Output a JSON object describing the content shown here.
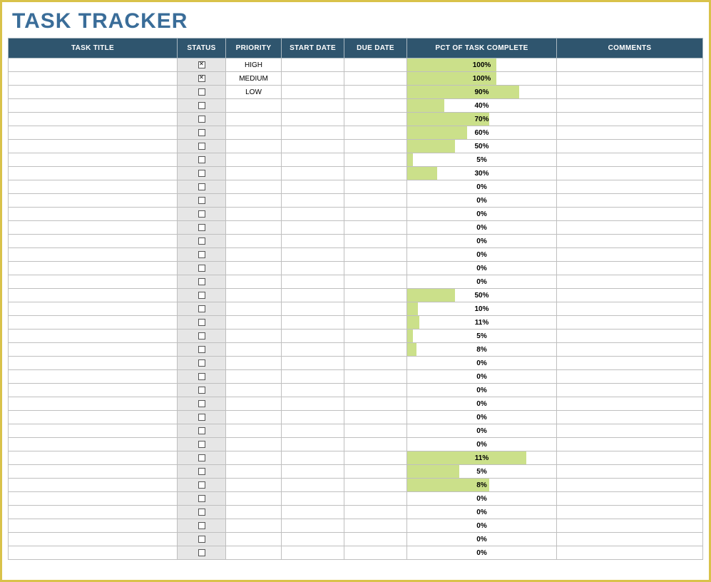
{
  "tracker": {
    "title": "TASK TRACKER",
    "columns": {
      "task_title": "TASK TITLE",
      "status": "STATUS",
      "priority": "PRIORITY",
      "start_date": "START DATE",
      "due_date": "DUE DATE",
      "pct_complete": "PCT OF TASK COMPLETE",
      "comments": "COMMENTS"
    },
    "rows": [
      {
        "task_title": "",
        "status_checked": true,
        "priority": "HIGH",
        "start_date": "",
        "due_date": "",
        "pct": 100,
        "pct_bar": 60,
        "comments": ""
      },
      {
        "task_title": "",
        "status_checked": true,
        "priority": "MEDIUM",
        "start_date": "",
        "due_date": "",
        "pct": 100,
        "pct_bar": 60,
        "comments": ""
      },
      {
        "task_title": "",
        "status_checked": false,
        "priority": "LOW",
        "start_date": "",
        "due_date": "",
        "pct": 90,
        "pct_bar": 75,
        "comments": ""
      },
      {
        "task_title": "",
        "status_checked": false,
        "priority": "",
        "start_date": "",
        "due_date": "",
        "pct": 40,
        "pct_bar": 25,
        "comments": ""
      },
      {
        "task_title": "",
        "status_checked": false,
        "priority": "",
        "start_date": "",
        "due_date": "",
        "pct": 70,
        "pct_bar": 55,
        "comments": ""
      },
      {
        "task_title": "",
        "status_checked": false,
        "priority": "",
        "start_date": "",
        "due_date": "",
        "pct": 60,
        "pct_bar": 40,
        "comments": ""
      },
      {
        "task_title": "",
        "status_checked": false,
        "priority": "",
        "start_date": "",
        "due_date": "",
        "pct": 50,
        "pct_bar": 32,
        "comments": ""
      },
      {
        "task_title": "",
        "status_checked": false,
        "priority": "",
        "start_date": "",
        "due_date": "",
        "pct": 5,
        "pct_bar": 4,
        "comments": ""
      },
      {
        "task_title": "",
        "status_checked": false,
        "priority": "",
        "start_date": "",
        "due_date": "",
        "pct": 30,
        "pct_bar": 20,
        "comments": ""
      },
      {
        "task_title": "",
        "status_checked": false,
        "priority": "",
        "start_date": "",
        "due_date": "",
        "pct": 0,
        "pct_bar": 0,
        "comments": ""
      },
      {
        "task_title": "",
        "status_checked": false,
        "priority": "",
        "start_date": "",
        "due_date": "",
        "pct": 0,
        "pct_bar": 0,
        "comments": ""
      },
      {
        "task_title": "",
        "status_checked": false,
        "priority": "",
        "start_date": "",
        "due_date": "",
        "pct": 0,
        "pct_bar": 0,
        "comments": ""
      },
      {
        "task_title": "",
        "status_checked": false,
        "priority": "",
        "start_date": "",
        "due_date": "",
        "pct": 0,
        "pct_bar": 0,
        "comments": ""
      },
      {
        "task_title": "",
        "status_checked": false,
        "priority": "",
        "start_date": "",
        "due_date": "",
        "pct": 0,
        "pct_bar": 0,
        "comments": ""
      },
      {
        "task_title": "",
        "status_checked": false,
        "priority": "",
        "start_date": "",
        "due_date": "",
        "pct": 0,
        "pct_bar": 0,
        "comments": ""
      },
      {
        "task_title": "",
        "status_checked": false,
        "priority": "",
        "start_date": "",
        "due_date": "",
        "pct": 0,
        "pct_bar": 0,
        "comments": ""
      },
      {
        "task_title": "",
        "status_checked": false,
        "priority": "",
        "start_date": "",
        "due_date": "",
        "pct": 0,
        "pct_bar": 0,
        "comments": ""
      },
      {
        "task_title": "",
        "status_checked": false,
        "priority": "",
        "start_date": "",
        "due_date": "",
        "pct": 50,
        "pct_bar": 32,
        "comments": ""
      },
      {
        "task_title": "",
        "status_checked": false,
        "priority": "",
        "start_date": "",
        "due_date": "",
        "pct": 10,
        "pct_bar": 7,
        "comments": ""
      },
      {
        "task_title": "",
        "status_checked": false,
        "priority": "",
        "start_date": "",
        "due_date": "",
        "pct": 11,
        "pct_bar": 8,
        "comments": ""
      },
      {
        "task_title": "",
        "status_checked": false,
        "priority": "",
        "start_date": "",
        "due_date": "",
        "pct": 5,
        "pct_bar": 4,
        "comments": ""
      },
      {
        "task_title": "",
        "status_checked": false,
        "priority": "",
        "start_date": "",
        "due_date": "",
        "pct": 8,
        "pct_bar": 6,
        "comments": ""
      },
      {
        "task_title": "",
        "status_checked": false,
        "priority": "",
        "start_date": "",
        "due_date": "",
        "pct": 0,
        "pct_bar": 0,
        "comments": ""
      },
      {
        "task_title": "",
        "status_checked": false,
        "priority": "",
        "start_date": "",
        "due_date": "",
        "pct": 0,
        "pct_bar": 0,
        "comments": ""
      },
      {
        "task_title": "",
        "status_checked": false,
        "priority": "",
        "start_date": "",
        "due_date": "",
        "pct": 0,
        "pct_bar": 0,
        "comments": ""
      },
      {
        "task_title": "",
        "status_checked": false,
        "priority": "",
        "start_date": "",
        "due_date": "",
        "pct": 0,
        "pct_bar": 0,
        "comments": ""
      },
      {
        "task_title": "",
        "status_checked": false,
        "priority": "",
        "start_date": "",
        "due_date": "",
        "pct": 0,
        "pct_bar": 0,
        "comments": ""
      },
      {
        "task_title": "",
        "status_checked": false,
        "priority": "",
        "start_date": "",
        "due_date": "",
        "pct": 0,
        "pct_bar": 0,
        "comments": ""
      },
      {
        "task_title": "",
        "status_checked": false,
        "priority": "",
        "start_date": "",
        "due_date": "",
        "pct": 0,
        "pct_bar": 0,
        "comments": ""
      },
      {
        "task_title": "",
        "status_checked": false,
        "priority": "",
        "start_date": "",
        "due_date": "",
        "pct": 11,
        "pct_bar": 80,
        "comments": ""
      },
      {
        "task_title": "",
        "status_checked": false,
        "priority": "",
        "start_date": "",
        "due_date": "",
        "pct": 5,
        "pct_bar": 35,
        "comments": ""
      },
      {
        "task_title": "",
        "status_checked": false,
        "priority": "",
        "start_date": "",
        "due_date": "",
        "pct": 8,
        "pct_bar": 55,
        "comments": ""
      },
      {
        "task_title": "",
        "status_checked": false,
        "priority": "",
        "start_date": "",
        "due_date": "",
        "pct": 0,
        "pct_bar": 0,
        "comments": ""
      },
      {
        "task_title": "",
        "status_checked": false,
        "priority": "",
        "start_date": "",
        "due_date": "",
        "pct": 0,
        "pct_bar": 0,
        "comments": ""
      },
      {
        "task_title": "",
        "status_checked": false,
        "priority": "",
        "start_date": "",
        "due_date": "",
        "pct": 0,
        "pct_bar": 0,
        "comments": ""
      },
      {
        "task_title": "",
        "status_checked": false,
        "priority": "",
        "start_date": "",
        "due_date": "",
        "pct": 0,
        "pct_bar": 0,
        "comments": ""
      },
      {
        "task_title": "",
        "status_checked": false,
        "priority": "",
        "start_date": "",
        "due_date": "",
        "pct": 0,
        "pct_bar": 0,
        "comments": ""
      }
    ]
  }
}
